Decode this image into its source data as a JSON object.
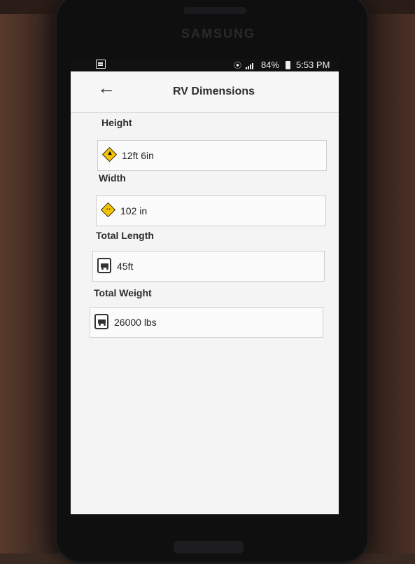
{
  "device": {
    "brand": "SAMSUNG"
  },
  "status_bar": {
    "battery": "84%",
    "time": "5:53 PM"
  },
  "app_bar": {
    "title": "RV Dimensions",
    "back_icon": "arrow-left-icon"
  },
  "fields": [
    {
      "label": "Height",
      "value": "12ft 6in",
      "icon": "height-sign-icon"
    },
    {
      "label": "Width",
      "value": "102 in",
      "icon": "width-sign-icon"
    },
    {
      "label": "Total Length",
      "value": "45ft",
      "icon": "truck-icon"
    },
    {
      "label": "Total Weight",
      "value": "26000 lbs",
      "icon": "truck-icon"
    }
  ],
  "colors": {
    "sign_yellow": "#f5c400",
    "screen_bg": "#f4f4f4"
  }
}
